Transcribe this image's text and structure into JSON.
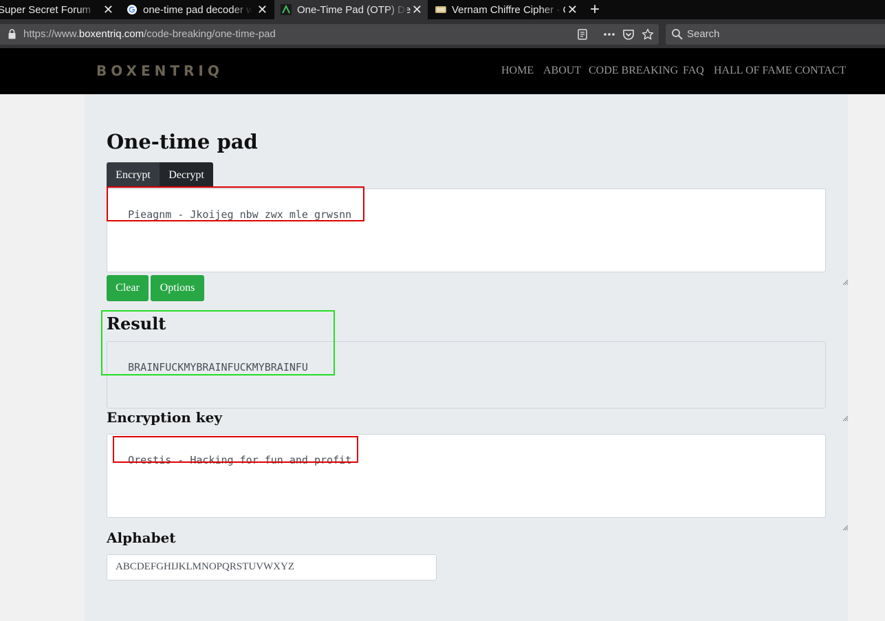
{
  "browser": {
    "tabs": [
      {
        "title": "Super Secret Forum",
        "active": false
      },
      {
        "title": "one-time pad decoder wi",
        "active": false
      },
      {
        "title": "One-Time Pad (OTP) Dec",
        "active": true
      },
      {
        "title": "Vernam Chiffre Cipher - C",
        "active": false
      }
    ],
    "close_glyph": "✕",
    "new_tab_glyph": "+",
    "url_prefix": "https://www.",
    "url_domain": "boxentriq.com",
    "url_path": "/code-breaking/one-time-pad",
    "search_placeholder": "Search"
  },
  "site": {
    "logo": "BOXENTRIQ",
    "nav": [
      "HOME",
      "ABOUT",
      "CODE BREAKING",
      "FAQ",
      "HALL OF FAME",
      "CONTACT"
    ]
  },
  "page": {
    "title": "One-time pad",
    "mode_tabs": [
      "Encrypt",
      "Decrypt"
    ],
    "input_text": "Pieagnm - Jkoijeg nbw zwx mle grwsnn",
    "clear_label": "Clear",
    "options_label": "Options",
    "result_heading": "Result",
    "result_text": "BRAINFUCKMYBRAINFUCKMYBRAINFU",
    "key_heading": "Encryption key",
    "key_text": "Orestis - Hacking for fun and profit",
    "alphabet_heading": "Alphabet",
    "alphabet_value": "ABCDEFGHIJKLMNOPQRSTUVWXYZ"
  },
  "colors": {
    "accent_green": "#28a745",
    "dark_button": "#343a40",
    "annotation_red": "#e00000",
    "annotation_green": "#22dd22"
  }
}
